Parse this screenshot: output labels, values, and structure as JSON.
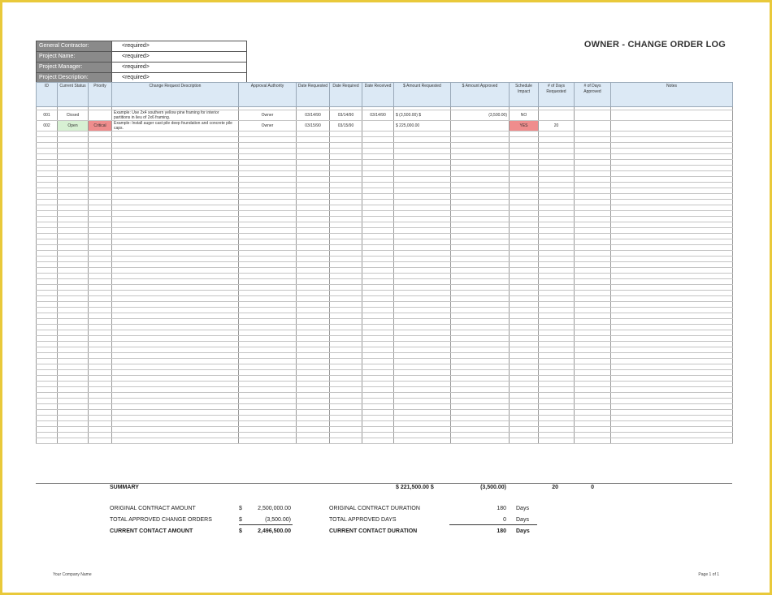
{
  "title": "OWNER - CHANGE ORDER LOG",
  "info": [
    {
      "label": "General Contractor:",
      "value": "<required>"
    },
    {
      "label": "Project Name:",
      "value": "<required>"
    },
    {
      "label": "Project Manager:",
      "value": "<required>"
    },
    {
      "label": "Project Description:",
      "value": "<required>"
    }
  ],
  "columns": [
    {
      "label": "ID",
      "width": 26
    },
    {
      "label": "Current Status",
      "width": 38
    },
    {
      "label": "Priority",
      "width": 29
    },
    {
      "label": "Change Request Description",
      "width": 156
    },
    {
      "label": "Approval Authority",
      "width": 71
    },
    {
      "label": "Date Requested",
      "width": 41
    },
    {
      "label": "Date Required",
      "width": 40
    },
    {
      "label": "Date Received",
      "width": 39
    },
    {
      "label": "$ Amount Requested",
      "width": 70
    },
    {
      "label": "$ Amount Approved",
      "width": 72
    },
    {
      "label": "Schedule Impact",
      "width": 36
    },
    {
      "label": "# of Days Requested",
      "width": 44
    },
    {
      "label": "# of Days Approved",
      "width": 45
    },
    {
      "label": "Notes",
      "width": 150
    }
  ],
  "rows": [
    {
      "id": "001",
      "status": "Closed",
      "status_color": "",
      "priority": "",
      "priority_color": "",
      "description": "Example:  Use 2x4 southern yellow pine framing for interior partitions in lieu of 2x6 framing.",
      "authority": "Owner",
      "date_requested": "03/14/90",
      "date_required": "03/14/90",
      "date_received": "03/14/90",
      "amount_requested": "$          (3,500.00)  $",
      "amount_approved": "(3,500.00)",
      "schedule_impact": "NO",
      "impact_color": "",
      "days_requested": "",
      "days_approved": "",
      "notes": ""
    },
    {
      "id": "002",
      "status": "Open",
      "status_color": "#d7f0d3",
      "priority": "Critical",
      "priority_color": "#ef8d8d",
      "description": "Example:  Install auger cast pile deep foundation and concrete pile caps.",
      "authority": "Owner",
      "date_requested": "03/15/90",
      "date_required": "03/15/90",
      "date_received": "",
      "amount_requested": "$          225,000.00",
      "amount_approved": "",
      "schedule_impact": "YES",
      "impact_color": "#ef8d8d",
      "days_requested": "20",
      "days_approved": "",
      "notes": ""
    }
  ],
  "summary": {
    "label": "SUMMARY",
    "amount_requested": "$          221,500.00  $",
    "amount_approved": "(3,500.00)",
    "days_requested": "20",
    "days_approved": "0"
  },
  "totals": {
    "original_amount_label": "ORIGINAL CONTRACT AMOUNT",
    "original_amount_currency": "$",
    "original_amount_value": "2,500,000.00",
    "approved_orders_label": "TOTAL APPROVED CHANGE ORDERS",
    "approved_orders_currency": "$",
    "approved_orders_value": "(3,500.00)",
    "current_amount_label": "CURRENT CONTACT AMOUNT",
    "current_amount_currency": "$",
    "current_amount_value": "2,496,500.00",
    "original_duration_label": "ORIGINAL CONTRACT DURATION",
    "original_duration_value": "180",
    "approved_days_label": "TOTAL APPROVED DAYS",
    "approved_days_value": "0",
    "current_duration_label": "CURRENT CONTACT DURATION",
    "current_duration_value": "180",
    "days_unit": "Days"
  },
  "footer": {
    "company": "Your Company Name",
    "page": "Page 1 of 1"
  }
}
